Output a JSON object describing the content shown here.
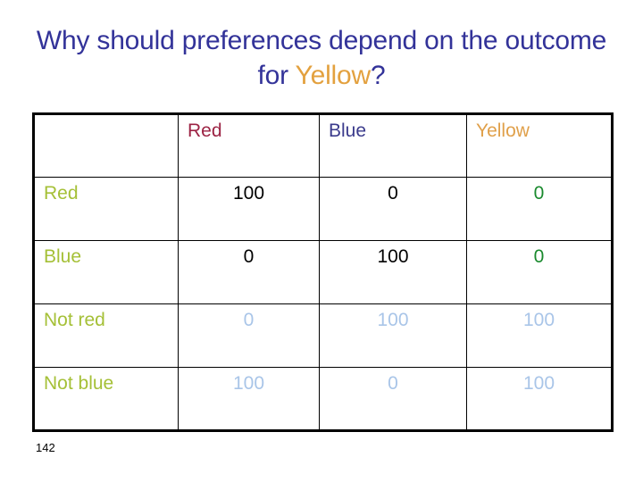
{
  "slide": {
    "title_part1": "Why should preferences depend on the outcome for ",
    "title_highlight": "Yellow",
    "title_part2": "?",
    "number": "142"
  },
  "table": {
    "corner_label": "",
    "columns": [
      {
        "label": "Red",
        "color": "#9c2344"
      },
      {
        "label": "Blue",
        "color": "#3b3b8c"
      },
      {
        "label": "Yellow",
        "color": "#e0a04a"
      }
    ],
    "rows": [
      {
        "label": "Red",
        "cells": [
          {
            "value": "100",
            "color": "#000000"
          },
          {
            "value": "0",
            "color": "#000000"
          },
          {
            "value": "0",
            "color": "#1a8a2e"
          }
        ]
      },
      {
        "label": "Blue",
        "cells": [
          {
            "value": "0",
            "color": "#000000"
          },
          {
            "value": "100",
            "color": "#000000"
          },
          {
            "value": "0",
            "color": "#1a8a2e"
          }
        ]
      },
      {
        "label": "Not red",
        "cells": [
          {
            "value": "0",
            "color": "#a9c5e8"
          },
          {
            "value": "100",
            "color": "#a9c5e8"
          },
          {
            "value": "100",
            "color": "#a9c5e8"
          }
        ]
      },
      {
        "label": "Not blue",
        "cells": [
          {
            "value": "100",
            "color": "#a9c5e8"
          },
          {
            "value": "0",
            "color": "#a9c5e8"
          },
          {
            "value": "100",
            "color": "#a9c5e8"
          }
        ]
      }
    ],
    "row_label_color": "#a5c037"
  },
  "theme": {
    "title_color": "#333399",
    "title_accent_color": "#e3a13f",
    "background": "#ffffff",
    "border_color": "#000000"
  }
}
